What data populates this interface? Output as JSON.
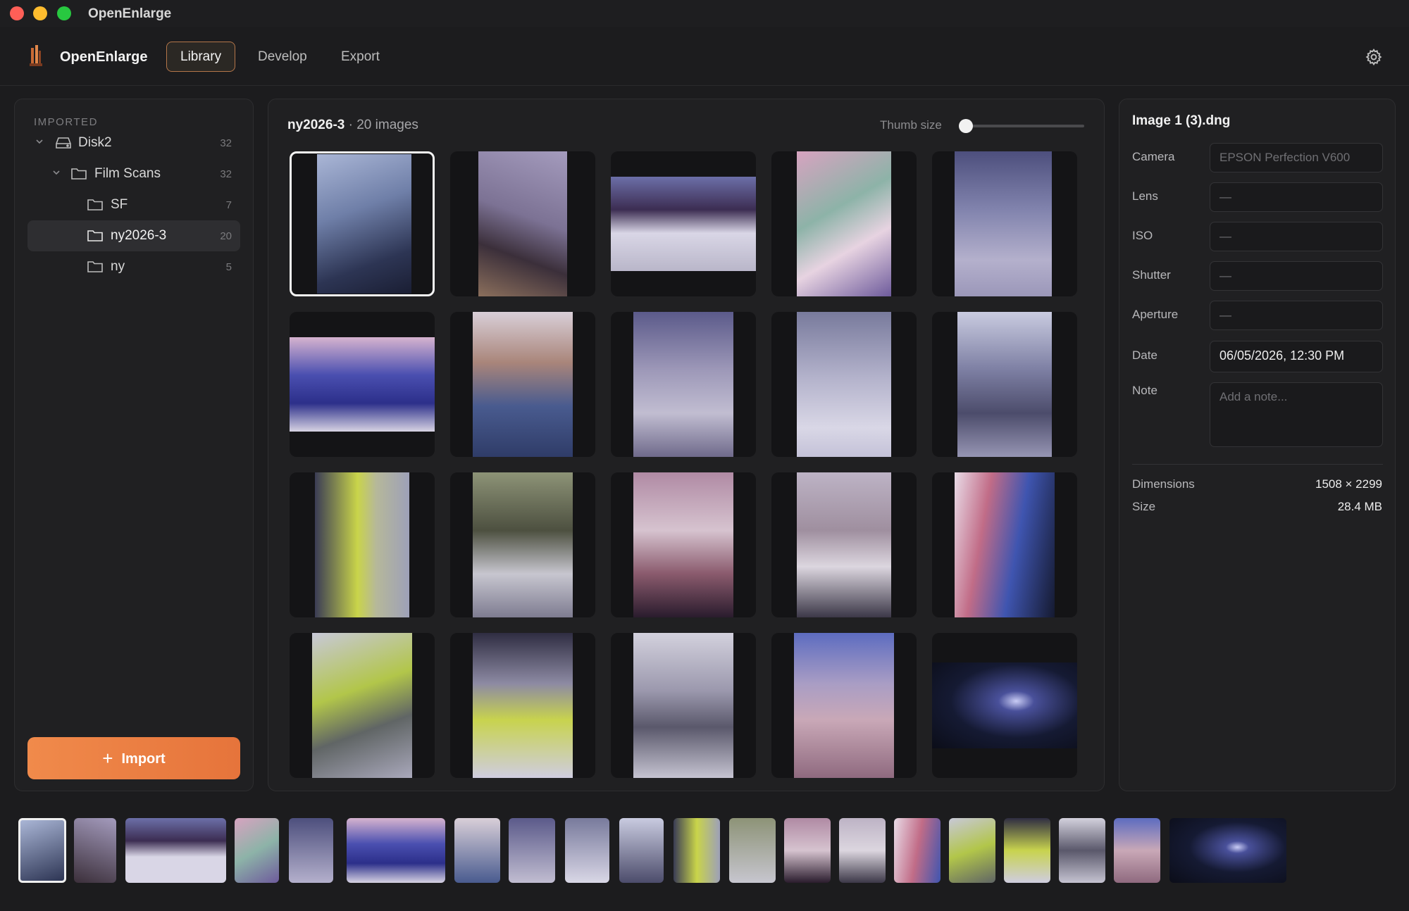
{
  "window": {
    "title": "OpenEnlarge"
  },
  "toolbar": {
    "brand": "OpenEnlarge",
    "tabs": [
      {
        "label": "Library",
        "active": true
      },
      {
        "label": "Develop",
        "active": false
      },
      {
        "label": "Export",
        "active": false
      }
    ],
    "settings_icon": "gear-icon"
  },
  "sidebar": {
    "section_label": "IMPORTED",
    "tree": [
      {
        "label": "Disk2",
        "count": "32",
        "icon": "drive-icon",
        "expanded": true,
        "selected": false
      },
      {
        "label": "Film Scans",
        "count": "32",
        "icon": "folder-icon",
        "expanded": true,
        "selected": false
      },
      {
        "label": "SF",
        "count": "7",
        "icon": "folder-icon",
        "selected": false
      },
      {
        "label": "ny2026-3",
        "count": "20",
        "icon": "folder-icon",
        "selected": true
      },
      {
        "label": "ny",
        "count": "5",
        "icon": "folder-icon",
        "selected": false
      }
    ],
    "import_label": "Import"
  },
  "gallery": {
    "folder_name": "ny2026-3",
    "count_text": "· 20 images",
    "thumb_size_label": "Thumb size",
    "thumb_size_value": 0,
    "selected_index": 0
  },
  "inspector": {
    "filename": "Image 1 (3).dng",
    "fields": [
      {
        "label": "Camera",
        "value": "EPSON Perfection V600",
        "filled": false
      },
      {
        "label": "Lens",
        "value": "—",
        "filled": false
      },
      {
        "label": "ISO",
        "value": "—",
        "filled": false
      },
      {
        "label": "Shutter",
        "value": "—",
        "filled": false
      },
      {
        "label": "Aperture",
        "value": "—",
        "filled": false
      },
      {
        "label": "Date",
        "value": "06/05/2026, 12:30 PM",
        "filled": true
      }
    ],
    "note": {
      "label": "Note",
      "placeholder": "Add a note..."
    },
    "meta": [
      {
        "label": "Dimensions",
        "value": "1508 × 2299"
      },
      {
        "label": "Size",
        "value": "28.4 MB"
      }
    ]
  },
  "colors": {
    "accent": "#e6743b",
    "selection_border": "#f4f4f4",
    "active_tab_border": "#b4764a"
  }
}
